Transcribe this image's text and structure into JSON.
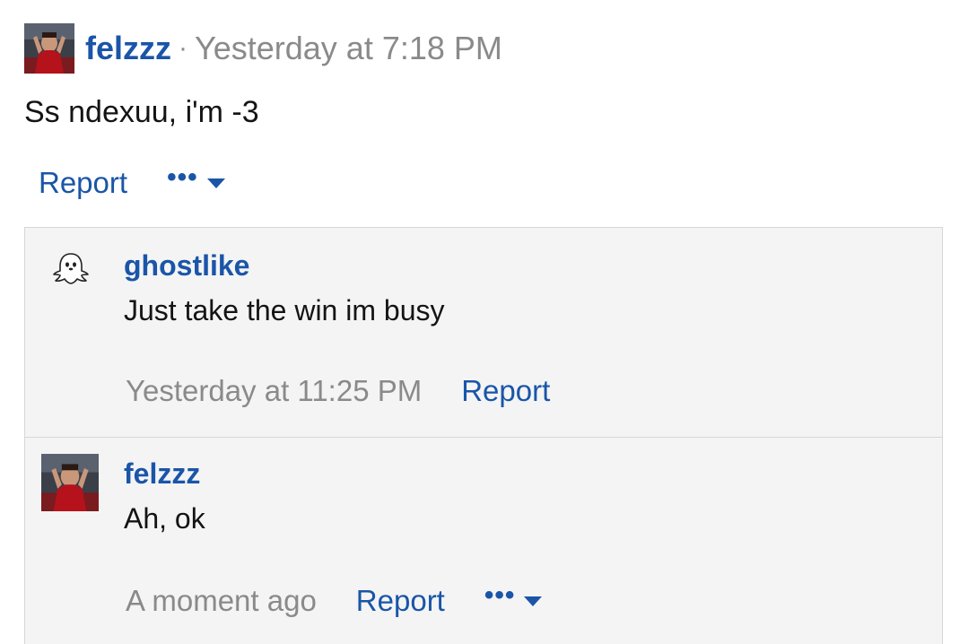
{
  "post": {
    "author": "felzzz",
    "separator": "·",
    "time": "Yesterday at 7:18 PM",
    "body": "Ss ndexuu, i'm -3",
    "report_label": "Report",
    "more_label": "•••"
  },
  "replies": [
    {
      "author": "ghostlike",
      "text": "Just take the win im busy",
      "time": "Yesterday at 11:25 PM",
      "report_label": "Report",
      "avatar_icon": "ghost-icon"
    },
    {
      "author": "felzzz",
      "text": "Ah, ok",
      "time": "A moment ago",
      "report_label": "Report",
      "more_label": "•••"
    }
  ],
  "colors": {
    "link": "#1a55a8",
    "muted": "#8a8a8a",
    "reply_bg": "#f4f4f4",
    "border": "#d6d6d6"
  }
}
